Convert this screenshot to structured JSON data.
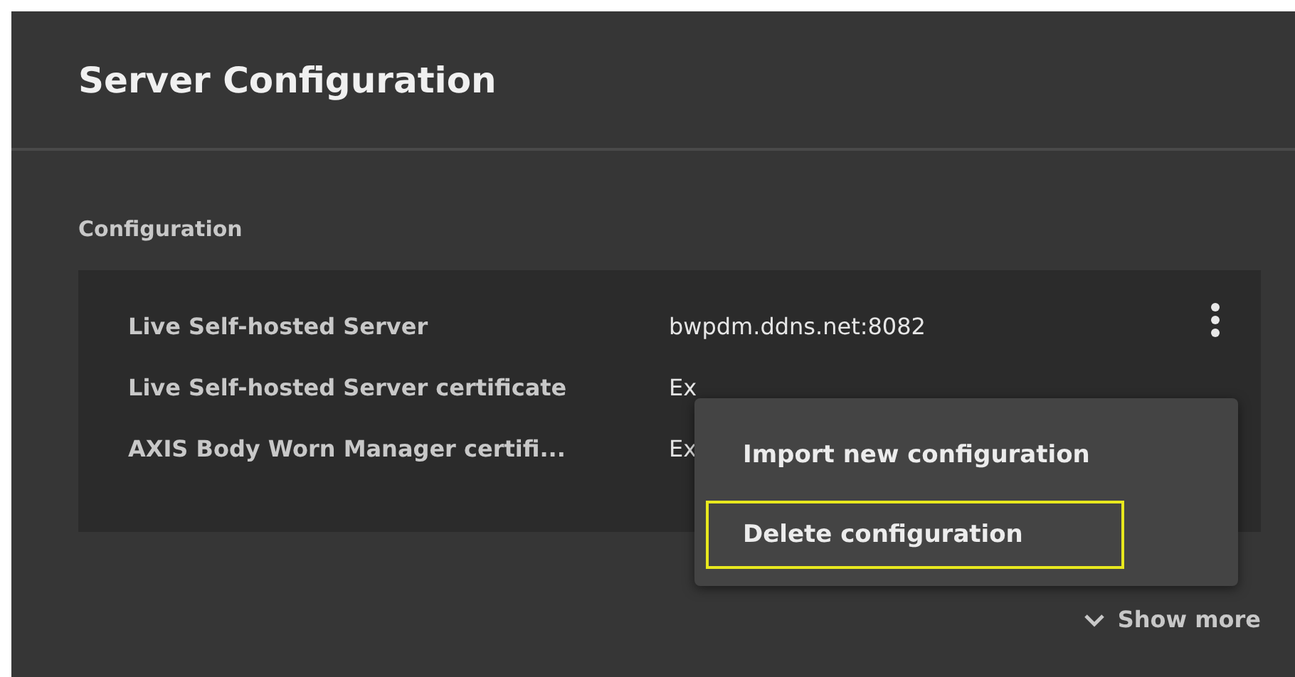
{
  "window": {
    "title": "Server Configuration"
  },
  "section": {
    "label": "Configuration"
  },
  "rows": [
    {
      "label": "Live Self-hosted Server",
      "value": "bwpdm.ddns.net:8082"
    },
    {
      "label": "Live Self-hosted Server certificate",
      "value": "Ex"
    },
    {
      "label": "AXIS Body Worn Manager certifi...",
      "value": "Ex"
    }
  ],
  "menu": {
    "items": [
      {
        "label": "Import new configuration",
        "focused": false
      },
      {
        "label": "Delete configuration",
        "focused": true
      }
    ]
  },
  "show_more": {
    "label": "Show more"
  }
}
